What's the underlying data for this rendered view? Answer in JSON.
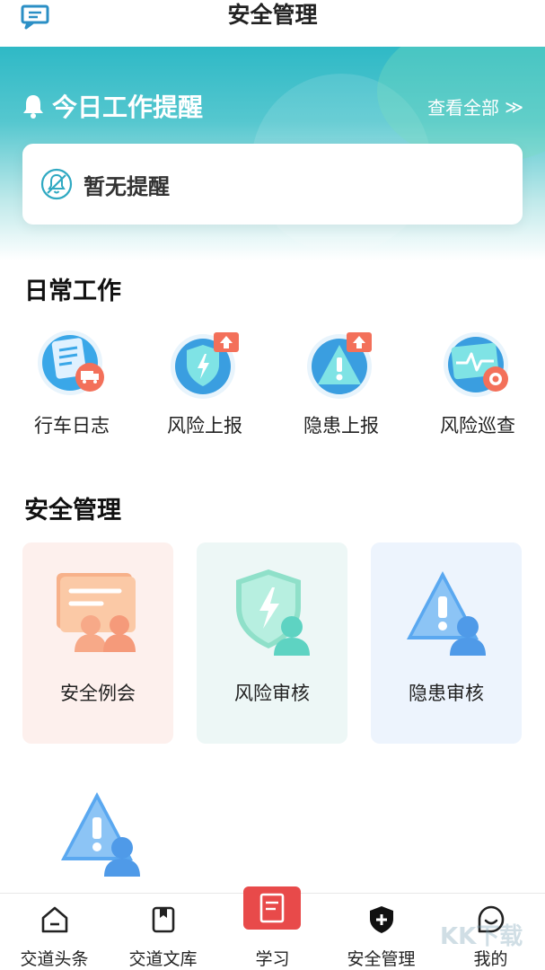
{
  "header": {
    "title": "安全管理",
    "message_icon": "message-icon"
  },
  "reminder": {
    "title": "今日工作提醒",
    "view_all": "查看全部",
    "view_all_chevron": "≫",
    "empty_text": "暂无提醒",
    "bell_icon": "bell-icon",
    "empty_icon": "bell-off-icon"
  },
  "daily": {
    "title": "日常工作",
    "items": [
      {
        "label": "行车日志",
        "icon": "driving-log-icon"
      },
      {
        "label": "风险上报",
        "icon": "risk-report-icon"
      },
      {
        "label": "隐患上报",
        "icon": "hazard-report-icon"
      },
      {
        "label": "风险巡查",
        "icon": "risk-inspection-icon"
      }
    ]
  },
  "safety": {
    "title": "安全管理",
    "cards": [
      {
        "label": "安全例会",
        "icon": "safety-meeting-icon",
        "bg": "#fdf0ed"
      },
      {
        "label": "风险审核",
        "icon": "risk-review-icon",
        "bg": "#edf7f6"
      },
      {
        "label": "隐患审核",
        "icon": "hazard-review-icon",
        "bg": "#edf4fd"
      }
    ],
    "extra_icon": "hazard-user-icon"
  },
  "tabbar": {
    "items": [
      {
        "label": "交道头条",
        "icon": "home-icon"
      },
      {
        "label": "交道文库",
        "icon": "library-icon"
      },
      {
        "label": "学习",
        "icon": "book-icon"
      },
      {
        "label": "安全管理",
        "icon": "shield-plus-icon"
      },
      {
        "label": "我的",
        "icon": "profile-icon"
      }
    ]
  },
  "watermark": "KK下载",
  "colors": {
    "brand_teal": "#2fb9c6",
    "study_red": "#e84a4a",
    "text_dark": "#222222"
  }
}
